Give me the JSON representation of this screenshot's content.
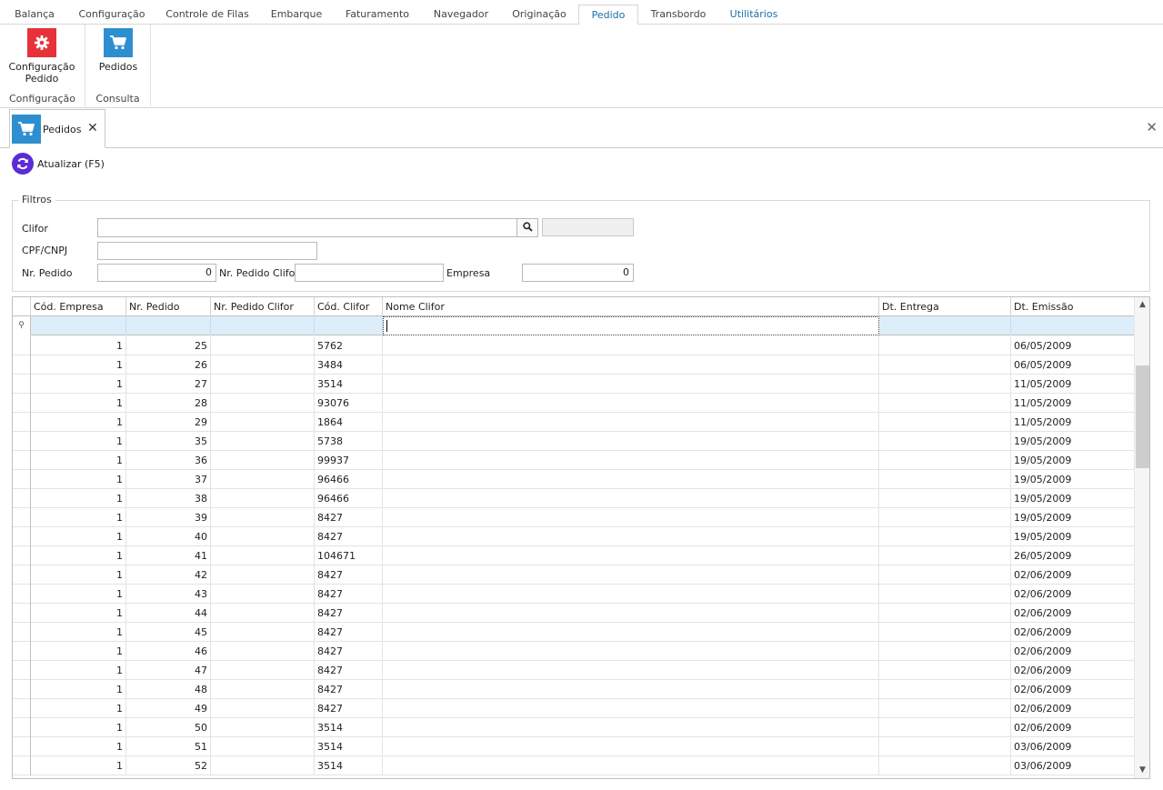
{
  "ribbon": {
    "tabs": [
      "Balança",
      "Configuração",
      "Controle de Filas",
      "Embarque",
      "Faturamento",
      "Navegador",
      "Originação",
      "Pedido",
      "Transbordo",
      "Utilitários"
    ],
    "active_tab": "Pedido",
    "groups": [
      {
        "button_label": "Configuração Pedido",
        "group_label": "Configuração",
        "icon": "gear-icon",
        "color": "#e8323a"
      },
      {
        "button_label": "Pedidos",
        "group_label": "Consulta",
        "icon": "cart-icon",
        "color": "#2e8fd0"
      }
    ]
  },
  "doc_tab": {
    "label": "Pedidos",
    "close": "✕"
  },
  "close_all": "✕",
  "refresh_label": "Atualizar (F5)",
  "filters": {
    "legend": "Filtros",
    "clifor_label": "Clifor",
    "clifor_value": "",
    "clifor_name": "",
    "cpf_label": "CPF/CNPJ",
    "cpf_value": "",
    "nr_pedido_label": "Nr. Pedido",
    "nr_pedido_value": "0",
    "nr_pedido_clifor_label": "Nr. Pedido Clifor",
    "nr_pedido_clifor_value": "",
    "empresa_label": "Empresa",
    "empresa_value": "0"
  },
  "grid": {
    "columns": [
      "Cód. Empresa",
      "Nr. Pedido",
      "Nr. Pedido Clifor",
      "Cód. Clifor",
      "Nome Clifor",
      "Dt. Entrega",
      "Dt. Emissão"
    ],
    "filter_indicator": "⚲",
    "rows": [
      [
        "1",
        "25",
        "",
        "5762",
        "",
        "",
        "06/05/2009"
      ],
      [
        "1",
        "26",
        "",
        "3484",
        "",
        "",
        "06/05/2009"
      ],
      [
        "1",
        "27",
        "",
        "3514",
        "",
        "",
        "11/05/2009"
      ],
      [
        "1",
        "28",
        "",
        "93076",
        "",
        "",
        "11/05/2009"
      ],
      [
        "1",
        "29",
        "",
        "1864",
        "",
        "",
        "11/05/2009"
      ],
      [
        "1",
        "35",
        "",
        "5738",
        "",
        "",
        "19/05/2009"
      ],
      [
        "1",
        "36",
        "",
        "99937",
        "",
        "",
        "19/05/2009"
      ],
      [
        "1",
        "37",
        "",
        "96466",
        "",
        "",
        "19/05/2009"
      ],
      [
        "1",
        "38",
        "",
        "96466",
        "",
        "",
        "19/05/2009"
      ],
      [
        "1",
        "39",
        "",
        "8427",
        "",
        "",
        "19/05/2009"
      ],
      [
        "1",
        "40",
        "",
        "8427",
        "",
        "",
        "19/05/2009"
      ],
      [
        "1",
        "41",
        "",
        "104671",
        "",
        "",
        "26/05/2009"
      ],
      [
        "1",
        "42",
        "",
        "8427",
        "",
        "",
        "02/06/2009"
      ],
      [
        "1",
        "43",
        "",
        "8427",
        "",
        "",
        "02/06/2009"
      ],
      [
        "1",
        "44",
        "",
        "8427",
        "",
        "",
        "02/06/2009"
      ],
      [
        "1",
        "45",
        "",
        "8427",
        "",
        "",
        "02/06/2009"
      ],
      [
        "1",
        "46",
        "",
        "8427",
        "",
        "",
        "02/06/2009"
      ],
      [
        "1",
        "47",
        "",
        "8427",
        "",
        "",
        "02/06/2009"
      ],
      [
        "1",
        "48",
        "",
        "8427",
        "",
        "",
        "02/06/2009"
      ],
      [
        "1",
        "49",
        "",
        "8427",
        "",
        "",
        "02/06/2009"
      ],
      [
        "1",
        "50",
        "",
        "3514",
        "",
        "",
        "02/06/2009"
      ],
      [
        "1",
        "51",
        "",
        "3514",
        "",
        "",
        "03/06/2009"
      ],
      [
        "1",
        "52",
        "",
        "3514",
        "",
        "",
        "03/06/2009"
      ]
    ]
  }
}
